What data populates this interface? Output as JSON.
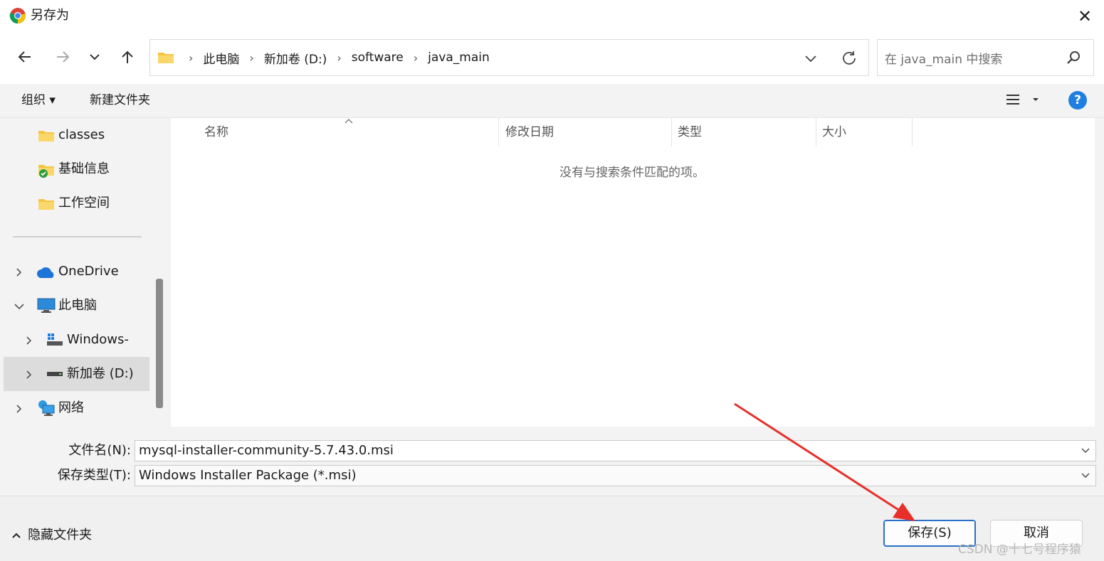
{
  "window": {
    "title": "另存为",
    "close_glyph": "✕"
  },
  "address_bar": {
    "breadcrumbs": [
      "此电脑",
      "新加卷 (D:)",
      "software",
      "java_main"
    ],
    "separator": "›"
  },
  "search": {
    "placeholder": "在 java_main 中搜索"
  },
  "toolbar": {
    "organize_label": "组织 ▾",
    "new_folder_label": "新建文件夹",
    "help_label": "?"
  },
  "nav_pane": {
    "items": [
      {
        "label": "classes",
        "icon": "folder-icon"
      },
      {
        "label": "基础信息",
        "icon": "folder-check-icon"
      },
      {
        "label": "工作空间",
        "icon": "folder-icon"
      },
      {
        "label": "OneDrive",
        "icon": "cloud-icon"
      },
      {
        "label": "此电脑",
        "icon": "computer-icon"
      },
      {
        "label": "Windows-SSD",
        "icon": "drive-windows-icon"
      },
      {
        "label": "新加卷 (D:)",
        "icon": "drive-icon",
        "selected": true
      },
      {
        "label": "网络",
        "icon": "network-icon"
      }
    ]
  },
  "file_list": {
    "columns": [
      "名称",
      "修改日期",
      "类型",
      "大小"
    ],
    "empty_message": "没有与搜索条件匹配的项。"
  },
  "form": {
    "filename_label": "文件名(N):",
    "filename_value": "mysql-installer-community-5.7.43.0.msi",
    "filetype_label": "保存类型(T):",
    "filetype_value": "Windows Installer Package (*.msi)"
  },
  "footer": {
    "hide_folders_label": "隐藏文件夹",
    "save_label": "保存(S)",
    "cancel_label": "取消",
    "watermark": "CSDN @十七号程序猿"
  },
  "colors": {
    "accent": "#1f7fe0",
    "annotation_arrow": "#e8302a"
  }
}
